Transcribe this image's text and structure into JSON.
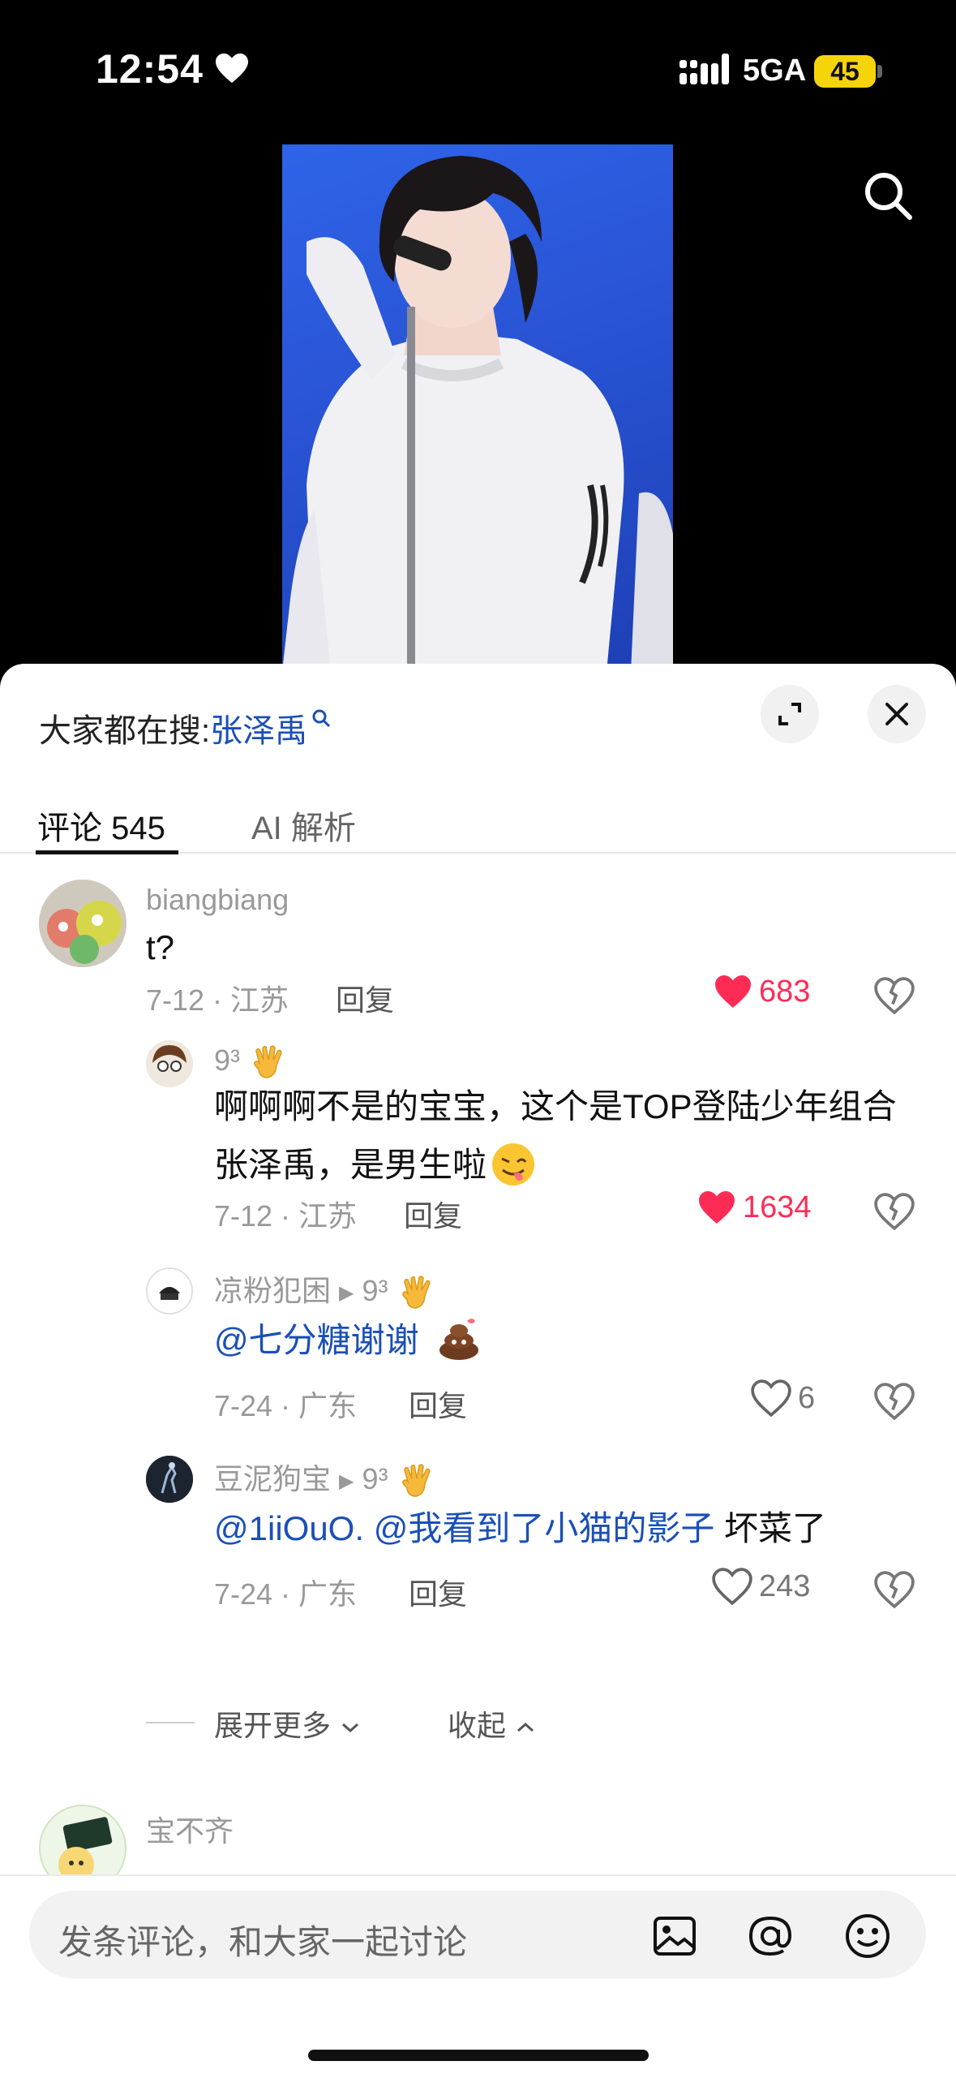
{
  "status": {
    "time": "12:54",
    "network": "5GA",
    "battery": "45"
  },
  "sheet": {
    "trending_prefix": "大家都在搜:",
    "trending_keyword": "张泽禹"
  },
  "tabs": [
    {
      "label": "评论 545"
    },
    {
      "label": "AI 解析"
    }
  ],
  "comments": [
    {
      "user": "biangbiang",
      "text": "t?",
      "date_loc": "7-12 · 江苏",
      "reply": "回复",
      "likes": "683"
    },
    {
      "user": "9³",
      "text": "啊啊啊不是的宝宝，这个是TOP登陆少年组合张泽禹，是男生啦",
      "date_loc": "7-12 · 江苏",
      "reply": "回复",
      "likes": "1634"
    },
    {
      "user": "凉粉犯困",
      "reply_to": "9³",
      "mention": "@七分糖谢谢",
      "text": "",
      "date_loc": "7-24 · 广东",
      "reply": "回复",
      "likes": "6"
    },
    {
      "user": "豆泥狗宝",
      "reply_to": "9³",
      "mention": "@1iiOuO. @我看到了小猫的影子",
      "text": " 坏菜了",
      "date_loc": "7-24 · 广东",
      "reply": "回复",
      "likes": "243"
    },
    {
      "user": "宝不齐",
      "text": "",
      "date_loc": "",
      "reply": "",
      "likes": ""
    }
  ],
  "thread": {
    "expand_more": "展开更多",
    "collapse": "收起"
  },
  "input": {
    "placeholder": "发条评论，和大家一起讨论"
  },
  "colors": {
    "accent_red": "#fe2c55",
    "mention_blue": "#1a4fb8"
  }
}
